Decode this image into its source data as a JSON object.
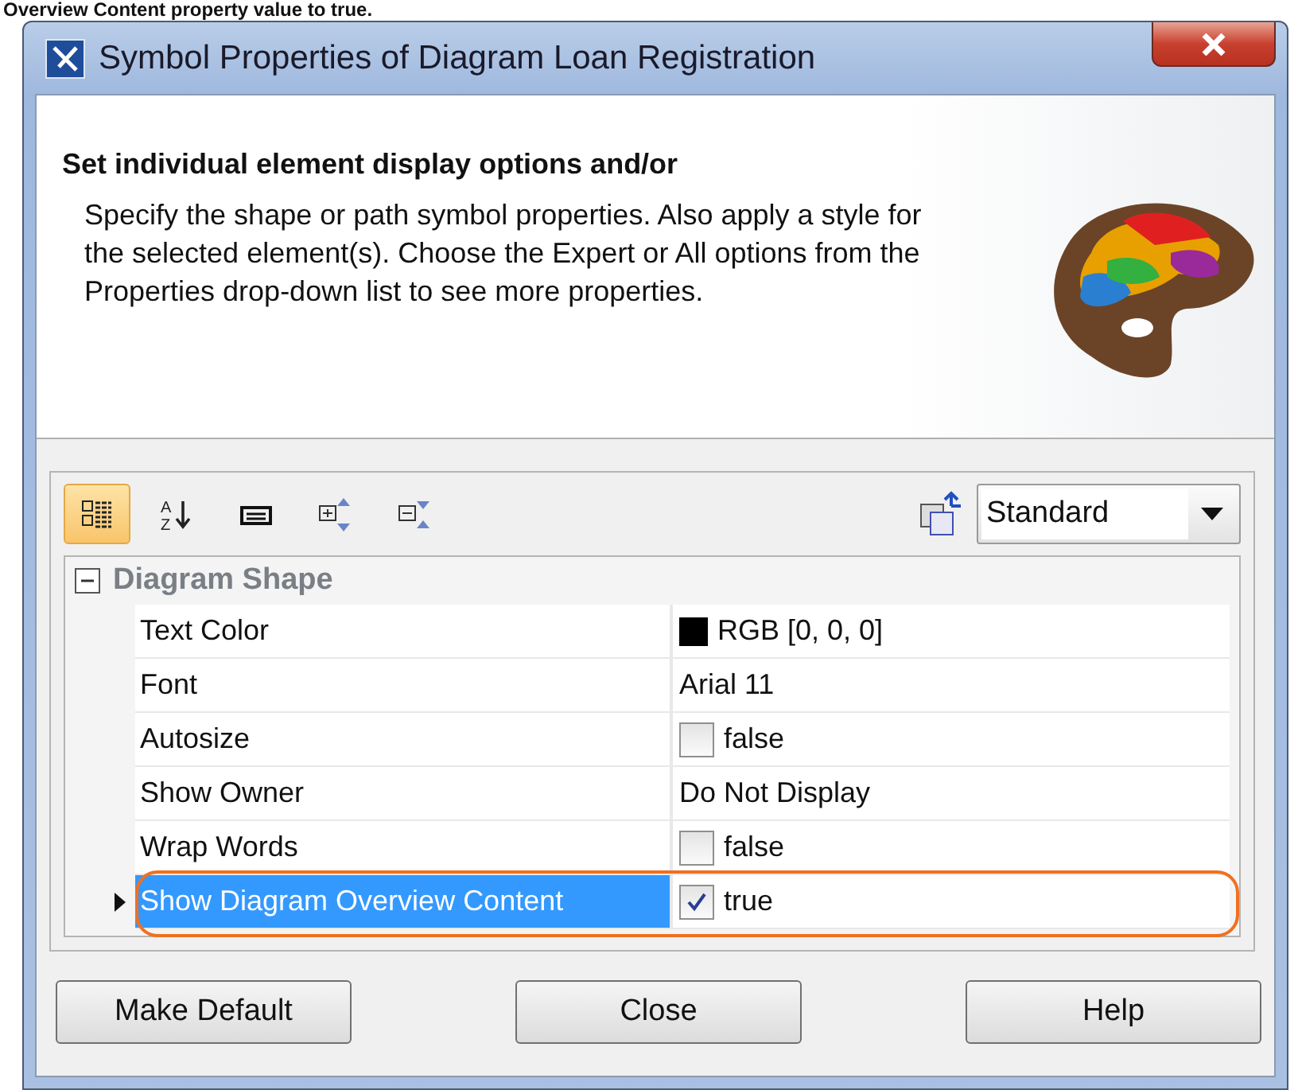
{
  "caption": "Overview Content property value to true.",
  "window": {
    "title": "Symbol Properties of Diagram Loan Registration"
  },
  "header": {
    "heading": "Set individual element display options and/or",
    "description": "Specify the shape or path symbol properties. Also apply a style for the selected element(s). Choose the Expert or All options from the Properties drop-down list to see more properties."
  },
  "toolbar": [
    {
      "kind": "categorized",
      "selected": true
    },
    {
      "kind": "sort",
      "selected": false,
      "glyphs": [
        "A",
        "Z"
      ]
    },
    {
      "kind": "description",
      "selected": false
    },
    {
      "kind": "expand",
      "selected": false
    },
    {
      "kind": "collapse",
      "selected": false
    }
  ],
  "properties_mode": {
    "value": "Standard"
  },
  "group": {
    "title": "Diagram Shape",
    "expanded": true,
    "rows": [
      {
        "name": "Text Color",
        "kind": "color",
        "value": "RGB [0, 0, 0]",
        "color": "#000000",
        "selected": false
      },
      {
        "name": "Font",
        "kind": "text",
        "value": "Arial 11",
        "selected": false
      },
      {
        "name": "Autosize",
        "kind": "checkbox",
        "checked": false,
        "value": "false",
        "selected": false
      },
      {
        "name": "Show Owner",
        "kind": "text",
        "value": "Do Not Display",
        "selected": false
      },
      {
        "name": "Wrap Words",
        "kind": "checkbox",
        "checked": false,
        "value": "false",
        "selected": false
      },
      {
        "name": "Show Diagram Overview Content",
        "kind": "checkbox",
        "checked": true,
        "value": "true",
        "selected": true
      }
    ]
  },
  "buttons": [
    "Make Default",
    "Close",
    "Help"
  ]
}
